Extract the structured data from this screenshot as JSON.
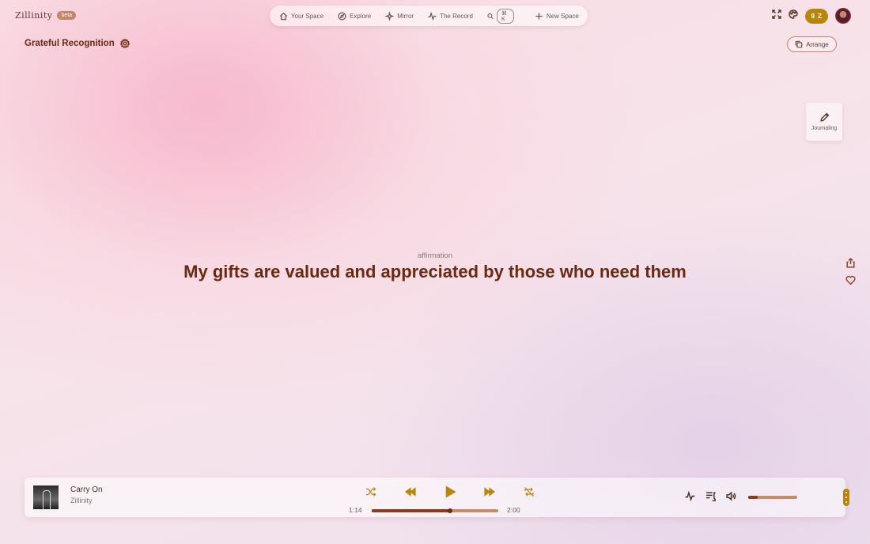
{
  "brand": {
    "name": "Zillinity",
    "tag": "beta"
  },
  "nav": {
    "items": [
      {
        "label": "Your Space",
        "icon": "home-icon"
      },
      {
        "label": "Explore",
        "icon": "compass-icon"
      },
      {
        "label": "Mirror",
        "icon": "sparkle-icon"
      },
      {
        "label": "The Record",
        "icon": "pulse-icon"
      }
    ],
    "search_shortcut": "⌘ K",
    "new_space": "New Space"
  },
  "header": {
    "coins": "9 Z"
  },
  "space": {
    "title": "Grateful Recognition",
    "arrange_label": "Arrange",
    "journaling_label": "Journaling"
  },
  "affirmation": {
    "label": "affirmation",
    "text": "My gifts are valued and appreciated by those who need them"
  },
  "player": {
    "track": "Carry On",
    "artist": "Zillinity",
    "elapsed": "1:14",
    "duration": "2:00",
    "progress_fraction": 0.62,
    "volume_fraction": 0.2
  },
  "colors": {
    "accent": "#b8860b",
    "text_primary": "#6b2a10"
  }
}
